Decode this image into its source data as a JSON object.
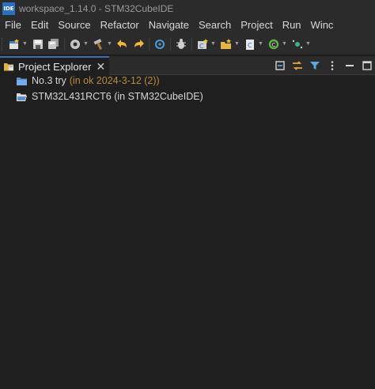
{
  "window": {
    "app_icon_text": "IDE",
    "title": "workspace_1.14.0 - STM32CubeIDE"
  },
  "menu": {
    "items": [
      "File",
      "Edit",
      "Source",
      "Refactor",
      "Navigate",
      "Search",
      "Project",
      "Run",
      "Winc"
    ]
  },
  "toolbar": {
    "icons": [
      "new-icon",
      "save-icon",
      "save-all-icon",
      "build-settings-icon",
      "build-hammer-icon",
      "back-icon",
      "forward-icon",
      "target-icon",
      "debug-icon",
      "new-c-project-icon",
      "open-project-icon",
      "new-source-icon",
      "refresh-icon",
      "ai-icon"
    ]
  },
  "view": {
    "tab_label": "Project Explorer",
    "icons": [
      "collapse-all-icon",
      "link-editor-icon",
      "filter-icon",
      "view-menu-icon",
      "minimize-icon",
      "maximize-icon"
    ]
  },
  "tree": {
    "items": [
      {
        "label": "No.3 try",
        "decoration": "(in ok  2024-3-12 (2))",
        "icon": "closed-folder-icon"
      },
      {
        "label": "STM32L431RCT6 (in STM32CubeIDE)",
        "decoration": "",
        "icon": "open-folder-icon"
      }
    ]
  },
  "colors": {
    "background": "#1f1f1f",
    "chrome": "#2b2b2b",
    "accent": "#3b6fb0",
    "decoration": "#b88a3c"
  }
}
